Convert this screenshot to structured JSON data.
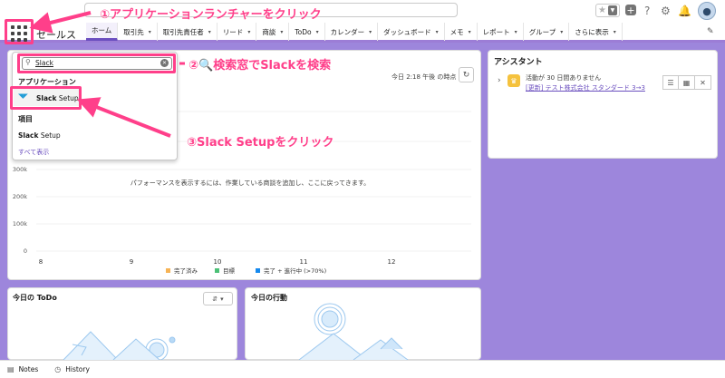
{
  "header": {
    "search_placeholder": "",
    "icons": [
      "star-icon",
      "dropdown-icon",
      "plus-icon",
      "help-icon",
      "gear-icon",
      "bell-icon",
      "avatar"
    ]
  },
  "nav": {
    "app_name": "セールス",
    "items": [
      {
        "label": "ホーム",
        "active": true,
        "chevron": false
      },
      {
        "label": "取引先",
        "active": false,
        "chevron": true
      },
      {
        "label": "取引先責任者",
        "active": false,
        "chevron": true
      },
      {
        "label": "リード",
        "active": false,
        "chevron": true
      },
      {
        "label": "商談",
        "active": false,
        "chevron": true
      },
      {
        "label": "ToDo",
        "active": false,
        "chevron": true
      },
      {
        "label": "カレンダー",
        "active": false,
        "chevron": true
      },
      {
        "label": "ダッシュボード",
        "active": false,
        "chevron": true
      },
      {
        "label": "メモ",
        "active": false,
        "chevron": true
      },
      {
        "label": "レポート",
        "active": false,
        "chevron": true
      },
      {
        "label": "グループ",
        "active": false,
        "chevron": true
      },
      {
        "label": "さらに表示",
        "active": false,
        "chevron": true
      }
    ]
  },
  "launcher": {
    "search_value": "Slack",
    "section_apps": "アプリケーション",
    "app_result": {
      "bold": "Slack",
      "rest": " Setup"
    },
    "section_items": "項目",
    "item_result": {
      "bold": "Slack",
      "rest": " Setup"
    },
    "view_all": "すべて表示"
  },
  "performance": {
    "time_text": "今日 2:18 午後 の時点",
    "empty_message": "パフォーマンスを表示するには、作業している商談を追加し、ここに戻ってきます。"
  },
  "chart_data": {
    "type": "line",
    "x_ticks": [
      "8",
      "9",
      "10",
      "11",
      "12"
    ],
    "y_ticks": [
      "300k",
      "200k",
      "100k",
      "0"
    ],
    "ylim": [
      0,
      300000
    ],
    "legend_position": "bottom",
    "legend": [
      {
        "name": "完了済み",
        "color": "#f6b355"
      },
      {
        "name": "目標",
        "color": "#4bc076"
      },
      {
        "name": "完了 + 進行中 (>70%)",
        "color": "#1589ee"
      }
    ],
    "series": []
  },
  "assistant": {
    "title": "アシスタント",
    "activity_text": "活動が 30 日間ありません",
    "link_text": "[更新] テスト株式会社 スタンダード 3→3"
  },
  "todo": {
    "title": "今日の ToDo"
  },
  "activity": {
    "title": "今日の行動"
  },
  "footer": {
    "notes": "Notes",
    "history": "History"
  },
  "annotations": {
    "step1": "①アプリケーションランチャーをクリック",
    "step2": "②🔍検索窓でSlackを検索",
    "step3": "③Slack Setupをクリック",
    "color": "#ff3f8a"
  }
}
